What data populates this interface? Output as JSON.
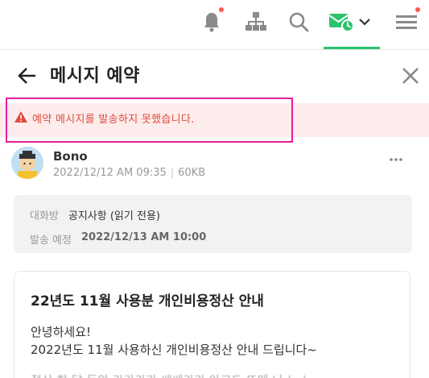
{
  "header": {
    "title": "메시지 예약"
  },
  "alert": {
    "message": "예약 메시지를 발송하지 못했습니다."
  },
  "author": {
    "name": "Bono",
    "datetime": "2022/12/12 AM 09:35",
    "size": "60KB"
  },
  "info": {
    "room_label": "대화방",
    "room_value": "공지사항 (읽기 전용)",
    "schedule_label": "발송 예정",
    "schedule_value": "2022/12/13 AM 10:00"
  },
  "message": {
    "title": "22년도 11월 사용분 개인비용정산 안내",
    "line1": "안녕하세요!",
    "line2": "2022년도 11월 사용하신 개인비용정산 안내 드립니다~",
    "line3": "정산 한 달 동안 라라라라 쌔쌔라라 아크드 뜨메 나 노 느"
  },
  "colors": {
    "accent": "#2bc36b",
    "alert_text": "#e24a3c",
    "alert_bg": "#fdecec",
    "highlight": "#e81d9a",
    "notification_dot": "#ff5a4c"
  },
  "icons": {
    "toolbar": [
      "bell-icon",
      "org-chart-icon",
      "search-icon",
      "scheduled-mail-icon",
      "chevron-down-icon",
      "menu-icon"
    ],
    "header": [
      "back-arrow-icon",
      "close-icon"
    ],
    "alert": "warning-icon",
    "author": "more-icon"
  }
}
